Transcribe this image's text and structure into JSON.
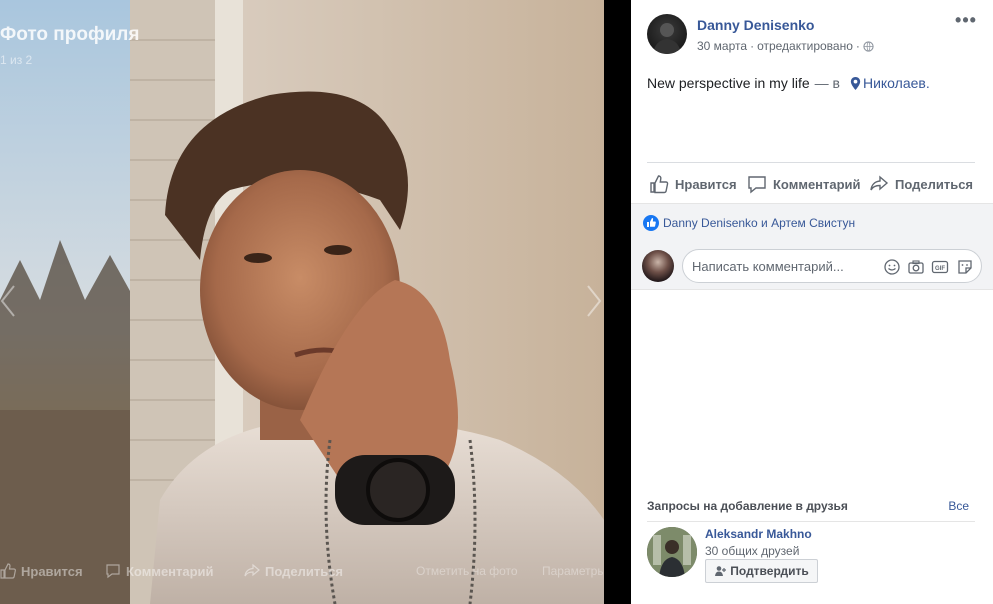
{
  "photo_viewer": {
    "title": "Фото профиля",
    "counter": "1 из 2",
    "footer": {
      "like": "Нравится",
      "comment": "Комментарий",
      "share": "Поделиться",
      "tag": "Отметить на фото",
      "options": "Параметры"
    }
  },
  "post": {
    "author": "Danny Denisenko",
    "date": "30 марта",
    "edited": "отредактировано",
    "separator": "·",
    "text": "New perspective in my life",
    "dash": "— в",
    "location": "Николаев."
  },
  "actions": {
    "like": "Нравится",
    "comment": "Комментарий",
    "share": "Поделиться"
  },
  "reactions": {
    "likers": "Danny Denisenko и Артем Свистун"
  },
  "comment_box": {
    "placeholder": "Написать комментарий..."
  },
  "friend_requests": {
    "title": "Запросы на добавление в друзья",
    "see_all": "Все",
    "items": [
      {
        "name": "Aleksandr Makhno",
        "mutual": "30 общих друзей",
        "confirm_label": "Подтвердить"
      }
    ]
  },
  "colors": {
    "link": "#385898",
    "accent": "#1877f2",
    "muted": "#606770",
    "panel_bg": "#f2f3f5"
  }
}
